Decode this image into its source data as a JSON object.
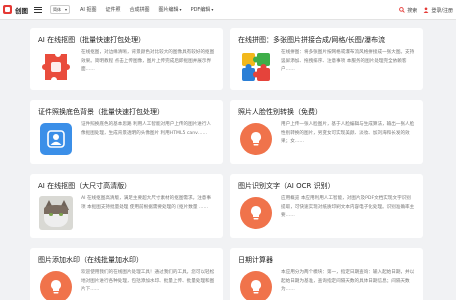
{
  "header": {
    "logo_text": "创图",
    "lang_select": "简体",
    "nav": [
      {
        "label": "AI 抠图",
        "has_caret": false
      },
      {
        "label": "证件照",
        "has_caret": false
      },
      {
        "label": "合成拼图",
        "has_caret": false
      },
      {
        "label": "图片编辑",
        "has_caret": true
      },
      {
        "label": "PDF编辑",
        "has_caret": true
      }
    ],
    "search_label": "搜索",
    "login_label": "登录/注册",
    "caret_glyph": "▾"
  },
  "cards": [
    {
      "title": "AI 在线抠图（批量快速打包处理）",
      "description": "在线抠图，对边缘清晰，背景颜色对比较大的图像具有较好的抠图效果。简明教程 点击上传图像，图片上传完成后即抠图并展示界面……",
      "icon": "puzzle-icon"
    },
    {
      "title": "在线拼图：多张图片拼接合成/网格/长图/瀑布流",
      "description": "在线拼图：将多张图片按网格或瀑布流风格拼接成一张大图。支持竖屏添加、拖拽排序、注意事项 本服务的图片处理完全依赖客户……",
      "icon": "colorful-puzzle-icon"
    },
    {
      "title": "证件照换底色背景（批量快速打包处理）",
      "description": "证件照换底色的基本思路 利用人工智能对用户上传的图片进行人像抠图处理，生成背景透明的头像图片 利用HTML5 canv……",
      "icon": "id-card-icon"
    },
    {
      "title": "照片人脸性别转换（免费）",
      "description": "用户上传一张人脸图片，基于人脸编辑与生成算法，输出一张人脸性别转换的图片，男变女可实现美颜、淡妆、加刘海和长发的效果；女……",
      "icon": "bulb-icon"
    },
    {
      "title": "AI 在线抠图（大尺寸高清版）",
      "description": "AI 在线抠图高清版，满足主要超大尺寸素材的抠图需求。注意事项 本抠图支持批量处理 使用前根据需要处理的 [抠片数量 ……",
      "icon": "cat-photo"
    },
    {
      "title": "图片识别文字（AI OCR 识别）",
      "description": "应用概览 本应用利用人工智能，对图片及PDF文档实现文字识别提取，可快速实现对纸质印刷文本内容电子化处理。识别准确率主要……",
      "icon": "bulb-icon"
    },
    {
      "title": "图片添加水印（在线批量加水印）",
      "description": "欢迎使用我们的在线图片处理工具！通过我们的工具，您可以轻松地对图片进行各种处理，包括添加水印、批量上传、批量处理和图片下……",
      "icon": "bulb-icon"
    },
    {
      "title": "日期计算器",
      "description": "本应用分为两个模块：第一，指定日期查询：输入起始日期，并以起始日期为基准，查询指定间隔天数的具体日期信息；间隔天数为……",
      "icon": "bulb-icon"
    }
  ],
  "colors": {
    "accent_red": "#e53935",
    "bulb_orange": "#f0734b",
    "id_card_blue": "#3b8fe8",
    "page_bg": "#f1f2f4"
  }
}
